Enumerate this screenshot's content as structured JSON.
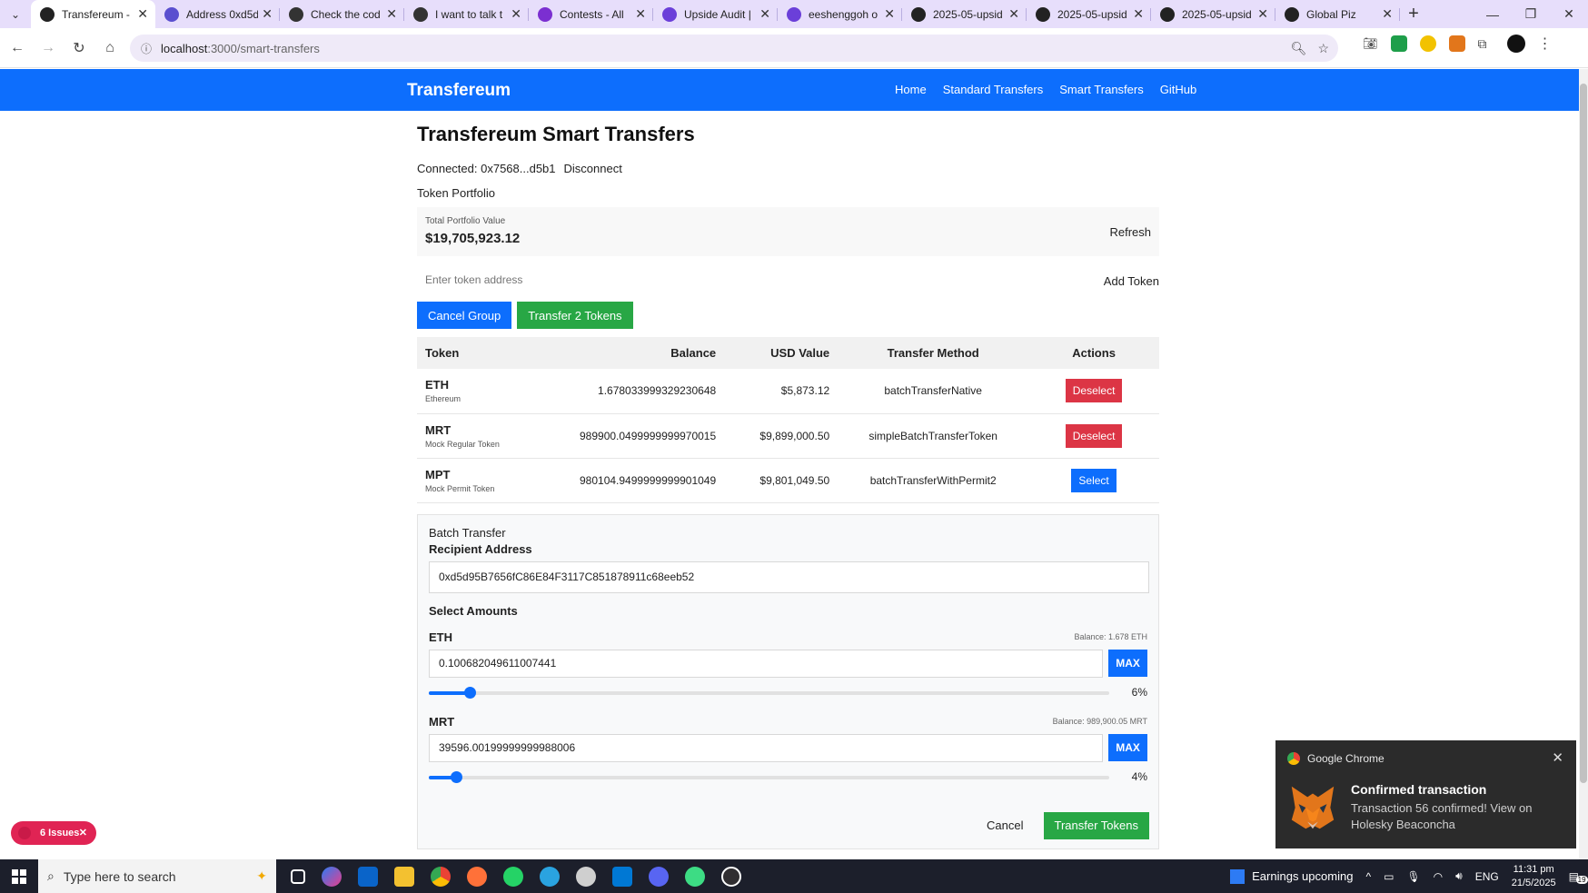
{
  "browser": {
    "tabs": [
      {
        "label": "Transfereum - ",
        "color": "#222222",
        "active": true
      },
      {
        "label": "Address 0xd5d",
        "color": "#5a4fcf",
        "active": false
      },
      {
        "label": "Check the cod",
        "color": "#333333",
        "active": false
      },
      {
        "label": "I want to talk t",
        "color": "#333333",
        "active": false
      },
      {
        "label": "Contests - All",
        "color": "#7b2fd1",
        "active": false
      },
      {
        "label": "Upside Audit |",
        "color": "#6b3fd9",
        "active": false
      },
      {
        "label": "eeshenggoh o",
        "color": "#6b3fd9",
        "active": false
      },
      {
        "label": "2025-05-upsid",
        "color": "#222222",
        "active": false
      },
      {
        "label": "2025-05-upsid",
        "color": "#222222",
        "active": false
      },
      {
        "label": "2025-05-upsid",
        "color": "#222222",
        "active": false
      },
      {
        "label": "Global Piz",
        "color": "#222222",
        "active": false
      }
    ],
    "url_host": "localhost",
    "url_path": ":3000/smart-transfers"
  },
  "navbar": {
    "brand": "Transfereum",
    "links": [
      "Home",
      "Standard Transfers",
      "Smart Transfers",
      "GitHub"
    ]
  },
  "page": {
    "title": "Transfereum Smart Transfers",
    "connected": "Connected: 0x7568...d5b1",
    "disconnect": "Disconnect",
    "portfolio_label": "Token Portfolio",
    "total_label": "Total Portfolio Value",
    "total_value": "$19,705,923.12",
    "refresh": "Refresh",
    "token_placeholder": "Enter token address",
    "add_token": "Add Token",
    "cancel_group": "Cancel Group",
    "transfer_n": "Transfer 2 Tokens",
    "table": {
      "headers": [
        "Token",
        "Balance",
        "USD Value",
        "Transfer Method",
        "Actions"
      ],
      "rows": [
        {
          "symbol": "ETH",
          "name": "Ethereum",
          "balance": "1.678033999329230648",
          "usd": "$5,873.12",
          "method": "batchTransferNative",
          "action": "Deselect",
          "action_color": "#dc3545"
        },
        {
          "symbol": "MRT",
          "name": "Mock Regular Token",
          "balance": "989900.0499999999970015",
          "usd": "$9,899,000.50",
          "method": "simpleBatchTransferToken",
          "action": "Deselect",
          "action_color": "#dc3545"
        },
        {
          "symbol": "MPT",
          "name": "Mock Permit Token",
          "balance": "980104.9499999999901049",
          "usd": "$9,801,049.50",
          "method": "batchTransferWithPermit2",
          "action": "Select",
          "action_color": "#0d6efd"
        }
      ]
    },
    "batch": {
      "title": "Batch Transfer",
      "recipient_label": "Recipient Address",
      "recipient_value": "0xd5d95B7656fC86E84F3117C851878911c68eeb52",
      "select_amounts": "Select Amounts",
      "assets": [
        {
          "symbol": "ETH",
          "balance": "Balance: 1.678 ETH",
          "amount": "0.100682049611007441",
          "max": "MAX",
          "percent": 6,
          "percent_label": "6%"
        },
        {
          "symbol": "MRT",
          "balance": "Balance: 989,900.05 MRT",
          "amount": "39596.00199999999988006",
          "max": "MAX",
          "percent": 4,
          "percent_label": "4%"
        }
      ],
      "cancel": "Cancel",
      "transfer": "Transfer Tokens"
    }
  },
  "issues": {
    "label": "6 Issues"
  },
  "notification": {
    "app": "Google Chrome",
    "title": "Confirmed transaction",
    "body": "Transaction 56 confirmed! View on Holesky Beaconcha"
  },
  "taskbar": {
    "search_placeholder": "Type here to search",
    "earnings": "Earnings upcoming",
    "lang": "ENG",
    "time": "11:31 pm",
    "date": "21/5/2025",
    "badge": "19"
  }
}
